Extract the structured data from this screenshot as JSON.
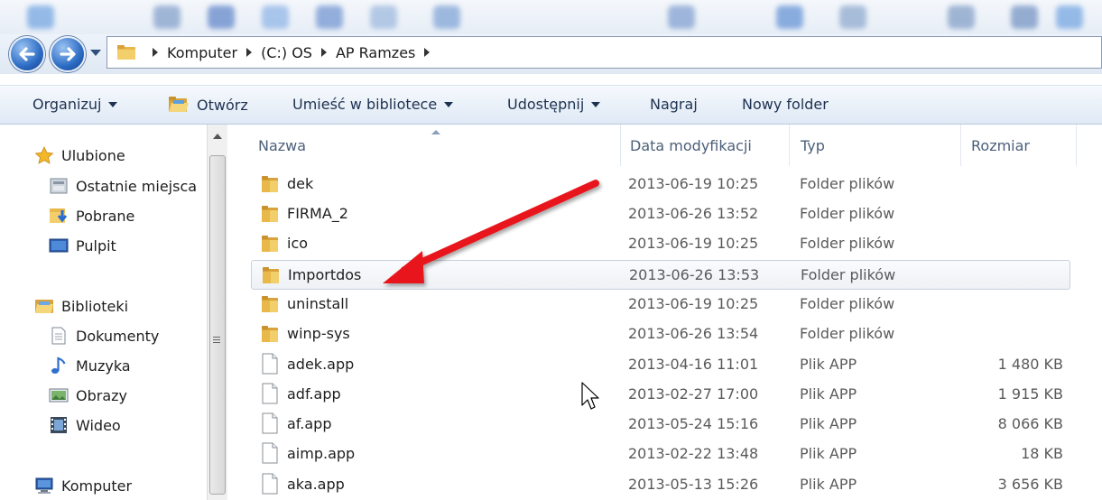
{
  "address": {
    "breadcrumbs": [
      "Komputer",
      "(C:) OS",
      "AP Ramzes"
    ]
  },
  "toolbar": {
    "organize": "Organizuj",
    "open": "Otwórz",
    "include_library": "Umieść w bibliotece",
    "share": "Udostępnij",
    "burn": "Nagraj",
    "new_folder": "Nowy folder"
  },
  "nav": {
    "favorites": "Ulubione",
    "recent": "Ostatnie miejsca",
    "downloads": "Pobrane",
    "desktop": "Pulpit",
    "libraries": "Biblioteki",
    "documents": "Dokumenty",
    "music": "Muzyka",
    "pictures": "Obrazy",
    "videos": "Wideo",
    "computer": "Komputer"
  },
  "columns": {
    "name": "Nazwa",
    "date": "Data modyfikacji",
    "type": "Typ",
    "size": "Rozmiar"
  },
  "files": [
    {
      "name": "dek",
      "date": "2013-06-19 10:25",
      "type": "Folder plików",
      "size": "",
      "icon": "folder-icon"
    },
    {
      "name": "FIRMA_2",
      "date": "2013-06-26 13:52",
      "type": "Folder plików",
      "size": "",
      "icon": "folder-icon"
    },
    {
      "name": "ico",
      "date": "2013-06-19 10:25",
      "type": "Folder plików",
      "size": "",
      "icon": "folder-icon"
    },
    {
      "name": "Importdos",
      "date": "2013-06-26 13:53",
      "type": "Folder plików",
      "size": "",
      "icon": "folder-icon"
    },
    {
      "name": "uninstall",
      "date": "2013-06-19 10:25",
      "type": "Folder plików",
      "size": "",
      "icon": "folder-icon"
    },
    {
      "name": "winp-sys",
      "date": "2013-06-26 13:54",
      "type": "Folder plików",
      "size": "",
      "icon": "folder-icon"
    },
    {
      "name": "adek.app",
      "date": "2013-04-16 11:01",
      "type": "Plik APP",
      "size": "1 480 KB",
      "icon": "file-icon"
    },
    {
      "name": "adf.app",
      "date": "2013-02-27 17:00",
      "type": "Plik APP",
      "size": "1 915 KB",
      "icon": "file-icon"
    },
    {
      "name": "af.app",
      "date": "2013-05-24 15:16",
      "type": "Plik APP",
      "size": "8 066 KB",
      "icon": "file-icon"
    },
    {
      "name": "aimp.app",
      "date": "2013-02-22 13:48",
      "type": "Plik APP",
      "size": "18 KB",
      "icon": "file-icon"
    },
    {
      "name": "aka.app",
      "date": "2013-05-13 15:26",
      "type": "Plik APP",
      "size": "3 656 KB",
      "icon": "file-icon"
    }
  ],
  "colors": {
    "highlight_arrow": "#e8191e",
    "folder": "#e8b84a",
    "toolbar_text": "#1e3250"
  }
}
